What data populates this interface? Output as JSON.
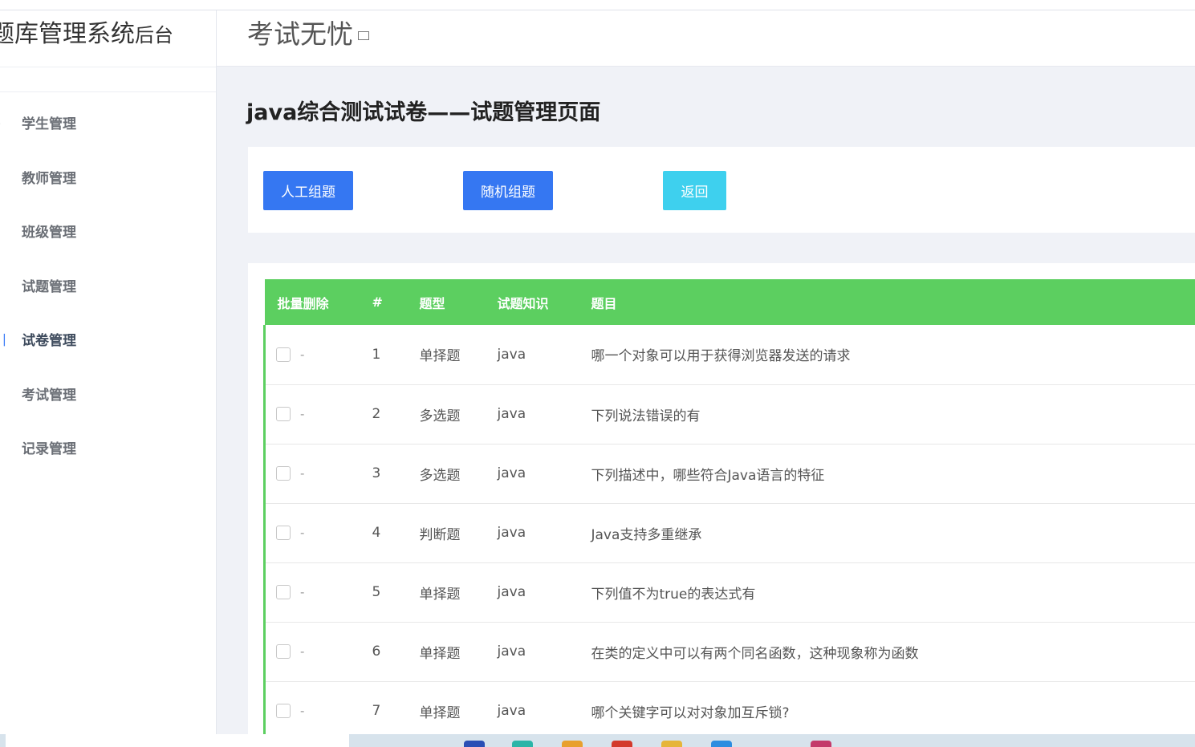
{
  "sidebar": {
    "brand_main": "题库管理系统",
    "brand_sub": "后台",
    "items": [
      {
        "label": "学生管理",
        "icon": "chevron-icon"
      },
      {
        "label": "教师管理",
        "icon": "dot-icon"
      },
      {
        "label": "班级管理",
        "icon": "doc-icon"
      },
      {
        "label": "试题管理",
        "icon": "edit-icon"
      },
      {
        "label": "试卷管理",
        "icon": "paper-icon"
      },
      {
        "label": "考试管理",
        "icon": "exam-icon"
      },
      {
        "label": "记录管理",
        "icon": "record-icon"
      }
    ],
    "active_index": 4
  },
  "header": {
    "title": "考试无忧"
  },
  "page": {
    "title": "java综合测试试卷——试题管理页面",
    "buttons": {
      "manual": "人工组题",
      "random": "随机组题",
      "back": "返回"
    }
  },
  "table": {
    "headers": [
      "批量删除",
      "#",
      "题型",
      "试题知识",
      "题目"
    ],
    "rows": [
      {
        "dash": "-",
        "id": "1",
        "type": "单择题",
        "knowledge": "java",
        "question": "哪一个对象可以用于获得浏览器发送的请求"
      },
      {
        "dash": "-",
        "id": "2",
        "type": "多选题",
        "knowledge": "java",
        "question": "下列说法错误的有"
      },
      {
        "dash": "-",
        "id": "3",
        "type": "多选题",
        "knowledge": "java",
        "question": "下列描述中，哪些符合Java语言的特征"
      },
      {
        "dash": "-",
        "id": "4",
        "type": "判断题",
        "knowledge": "java",
        "question": "Java支持多重继承"
      },
      {
        "dash": "-",
        "id": "5",
        "type": "单择题",
        "knowledge": "java",
        "question": "下列值不为true的表达式有"
      },
      {
        "dash": "-",
        "id": "6",
        "type": "单择题",
        "knowledge": "java",
        "question": "在类的定义中可以有两个同名函数，这种现象称为函数"
      },
      {
        "dash": "-",
        "id": "7",
        "type": "单择题",
        "knowledge": "java",
        "question": "哪个关键字可以对对象加互斥锁?"
      }
    ]
  },
  "colors": {
    "primary": "#3577f2",
    "info": "#3ed0ee",
    "table_header": "#5ccf60",
    "background": "#f0f2f7"
  }
}
